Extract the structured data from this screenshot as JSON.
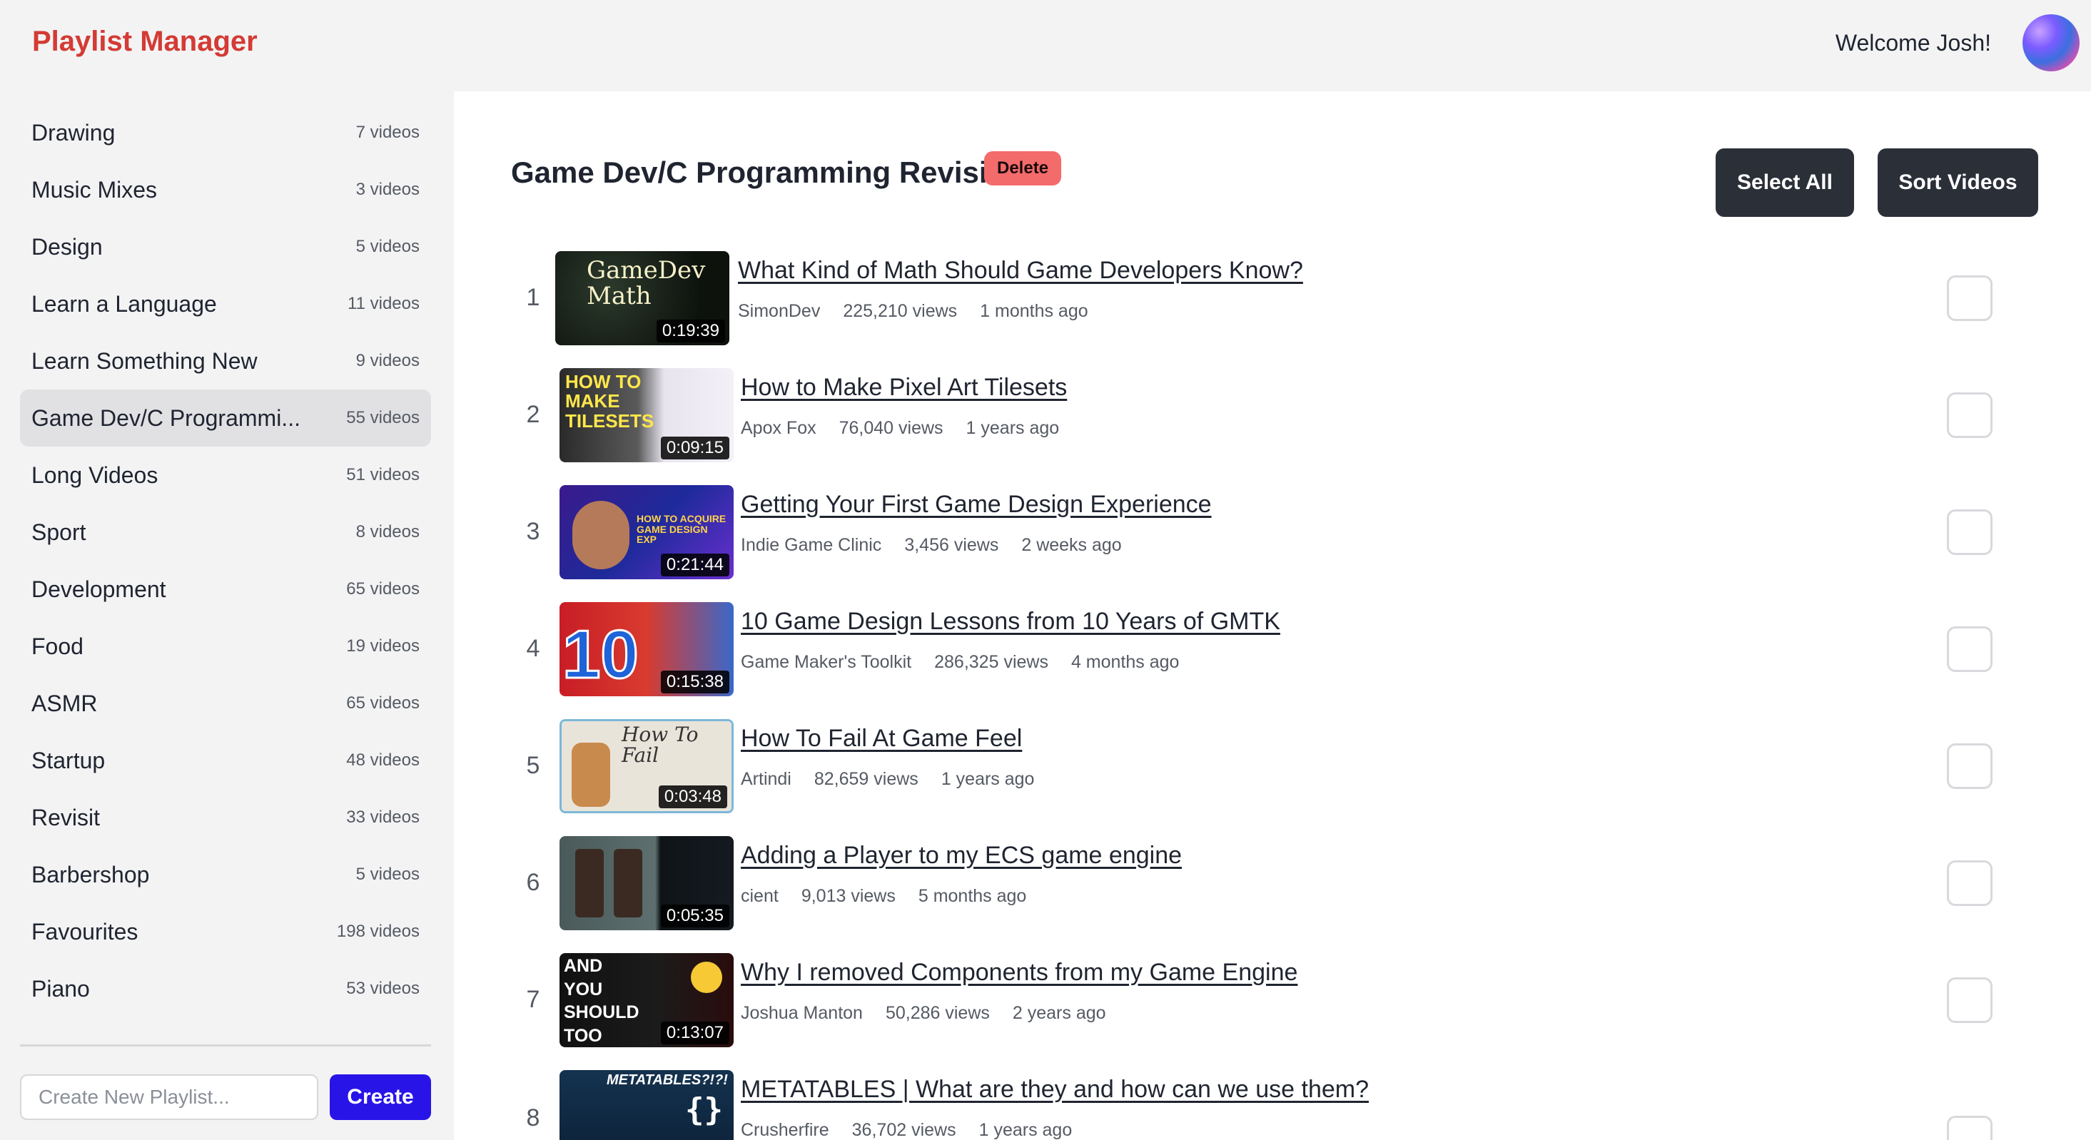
{
  "header": {
    "brand": "Playlist Manager",
    "welcome": "Welcome Josh!"
  },
  "sidebar": {
    "playlists": [
      {
        "name": "Drawing",
        "count": "7 videos"
      },
      {
        "name": "Music Mixes",
        "count": "3 videos"
      },
      {
        "name": "Design",
        "count": "5 videos"
      },
      {
        "name": "Learn a Language",
        "count": "11 videos"
      },
      {
        "name": "Learn Something New",
        "count": "9 videos"
      },
      {
        "name": "Game Dev/C Programmi...",
        "count": "55 videos",
        "active": true
      },
      {
        "name": "Long Videos",
        "count": "51 videos"
      },
      {
        "name": "Sport",
        "count": "8 videos"
      },
      {
        "name": "Development",
        "count": "65 videos"
      },
      {
        "name": "Food",
        "count": "19 videos"
      },
      {
        "name": "ASMR",
        "count": "65 videos"
      },
      {
        "name": "Startup",
        "count": "48 videos"
      },
      {
        "name": "Revisit",
        "count": "33 videos"
      },
      {
        "name": "Barbershop",
        "count": "5 videos"
      },
      {
        "name": "Favourites",
        "count": "198 videos"
      },
      {
        "name": "Piano",
        "count": "53 videos"
      }
    ],
    "new_playlist_placeholder": "Create New Playlist...",
    "create_label": "Create"
  },
  "main": {
    "title": "Game Dev/C Programming Revisit",
    "delete_label": "Delete",
    "select_all_label": "Select All",
    "sort_label": "Sort Videos",
    "videos": [
      {
        "index": "1",
        "title": "What Kind of Math Should Game Developers Know?",
        "channel": "SimonDev",
        "views": "225,210 views",
        "age": "1 months ago",
        "duration": "0:19:39",
        "thumb_text": "GameDev Math"
      },
      {
        "index": "2",
        "title": "How to Make Pixel Art Tilesets",
        "channel": "Apox Fox",
        "views": "76,040 views",
        "age": "1 years ago",
        "duration": "0:09:15",
        "thumb_text": "HOW TO MAKE TILESETS"
      },
      {
        "index": "3",
        "title": "Getting Your First Game Design Experience",
        "channel": "Indie Game Clinic",
        "views": "3,456 views",
        "age": "2 weeks ago",
        "duration": "0:21:44",
        "thumb_text": "HOW TO ACQUIRE GAME DESIGN EXP"
      },
      {
        "index": "4",
        "title": "10 Game Design Lessons from 10 Years of GMTK",
        "channel": "Game Maker's Toolkit",
        "views": "286,325 views",
        "age": "4 months ago",
        "duration": "0:15:38",
        "thumb_text": "10"
      },
      {
        "index": "5",
        "title": "How To Fail At Game Feel",
        "channel": "Artindi",
        "views": "82,659 views",
        "age": "1 years ago",
        "duration": "0:03:48",
        "thumb_text": "How To Fail"
      },
      {
        "index": "6",
        "title": "Adding a Player to my ECS game engine",
        "channel": "cient",
        "views": "9,013 views",
        "age": "5 months ago",
        "duration": "0:05:35",
        "thumb_text": ""
      },
      {
        "index": "7",
        "title": "Why I removed Components from my Game Engine",
        "channel": "Joshua Manton",
        "views": "50,286 views",
        "age": "2 years ago",
        "duration": "0:13:07",
        "thumb_text": "AND YOU SHOULD TOO"
      },
      {
        "index": "8",
        "title": "METATABLES | What are they and how can we use them?",
        "channel": "Crusherfire",
        "views": "36,702 views",
        "age": "1 years ago",
        "duration": "",
        "thumb_text": "METATABLES?!?!"
      }
    ]
  },
  "colors": {
    "brand": "#d33b34",
    "create_button": "#2914e8",
    "delete_badge": "#f46b6b",
    "dark_button": "#2b2f38"
  }
}
